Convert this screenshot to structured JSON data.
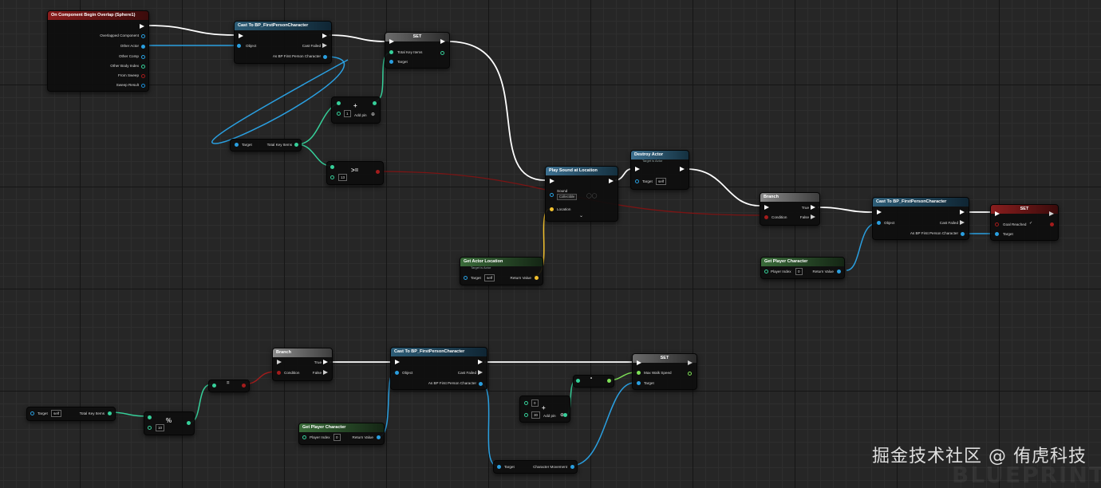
{
  "colors": {
    "exec": "#ffffff",
    "object": "#2a9fe0",
    "int": "#36d09a",
    "bool": "#a31c1c",
    "float": "#7ee057",
    "vector": "#f2c12e",
    "struct": "#1b5fa8"
  },
  "nodes": {
    "event": {
      "title": "On Component Begin Overlap (Sphere1)",
      "pins": [
        "Overlapped Component",
        "Other Actor",
        "Other Comp",
        "Other Body Index",
        "From Sweep",
        "Sweep Result"
      ]
    },
    "cast1": {
      "title": "Cast To BP_FirstPersonCharacter",
      "object": "Object",
      "cast_failed": "Cast Failed",
      "as_out": "As BP First Person Character"
    },
    "set1": {
      "title": "SET",
      "var": "Total Key Items",
      "target": "Target"
    },
    "add1": {
      "value": "1",
      "add_pin": "Add pin"
    },
    "getkeys1": {
      "target": "Target",
      "out": "Total Key Items"
    },
    "gte": {
      "op": ">=",
      "value": "13"
    },
    "playsound": {
      "title": "Play Sound at Location",
      "sound": "Sound",
      "sound_value": "Collectible",
      "location": "Location"
    },
    "destroy": {
      "title": "Destroy Actor",
      "subtitle": "Target is Actor",
      "target": "Target",
      "target_value": "self"
    },
    "getloc": {
      "title": "Get Actor Location",
      "subtitle": "Target is Actor",
      "target": "Target",
      "target_value": "self",
      "ret": "Return Value"
    },
    "branch1": {
      "title": "Branch",
      "condition": "Condition",
      "true": "True",
      "false": "False"
    },
    "cast2": {
      "title": "Cast To BP_FirstPersonCharacter",
      "object": "Object",
      "cast_failed": "Cast Failed",
      "as_out": "As BP First Person Character"
    },
    "setgoal": {
      "title": "SET",
      "var": "Goal Reached",
      "target": "Target"
    },
    "getplayer1": {
      "title": "Get Player Character",
      "index_label": "Player Index",
      "index": "0",
      "ret": "Return Value"
    },
    "branch2": {
      "title": "Branch",
      "condition": "Condition",
      "true": "True",
      "false": "False"
    },
    "eq": {
      "op": "="
    },
    "getkeys2": {
      "target": "Target",
      "target_value": "self",
      "out": "Total Key Items"
    },
    "mod": {
      "op": "%",
      "value": "10"
    },
    "cast3": {
      "title": "Cast To BP_FirstPersonCharacter",
      "object": "Object",
      "cast_failed": "Cast Failed",
      "as_out": "As BP First Person Character"
    },
    "getplayer2": {
      "title": "Get Player Character",
      "index_label": "Player Index",
      "index": "0",
      "ret": "Return Value"
    },
    "add2": {
      "op": "+",
      "a": "0",
      "b": "30",
      "add_pin": "Add pin"
    },
    "setspeed": {
      "title": "SET",
      "var": "Max Walk Speed",
      "target": "Target"
    },
    "charmove": {
      "target": "Target",
      "out": "Character Movement"
    }
  },
  "watermark": "掘金技术社区 @ 侑虎科技",
  "background_text": "BLUEPRINT"
}
